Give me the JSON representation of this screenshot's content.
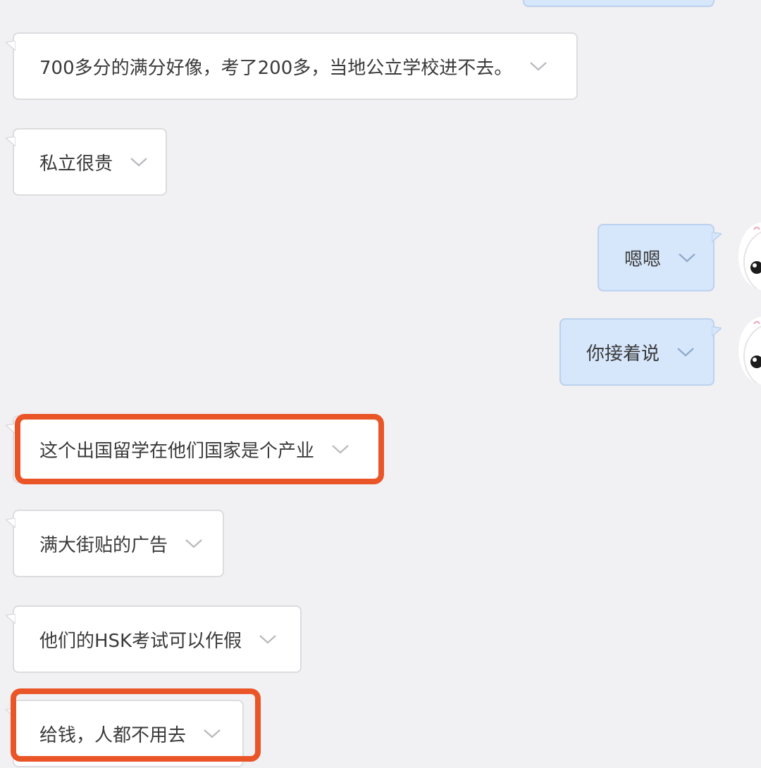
{
  "messages": [
    {
      "id": "m1",
      "side": "in",
      "text": "700多分的满分好像，考了200多，当地公立学校进不去。"
    },
    {
      "id": "m2",
      "side": "in",
      "text": "私立很贵"
    },
    {
      "id": "m3",
      "side": "out",
      "text": "嗯嗯"
    },
    {
      "id": "m4",
      "side": "out",
      "text": "你接着说"
    },
    {
      "id": "m5",
      "side": "in",
      "text": "这个出国留学在他们国家是个产业"
    },
    {
      "id": "m6",
      "side": "in",
      "text": "满大街贴的广告"
    },
    {
      "id": "m7",
      "side": "in",
      "text": "他们的HSK考试可以作假"
    },
    {
      "id": "m8",
      "side": "in",
      "text": "给钱，人都不用去"
    }
  ],
  "icons": {
    "expand": "chevron-down-icon",
    "avatar": "cartoon-avatar"
  },
  "colors": {
    "background": "#f1f0f3",
    "incoming_bubble": "#ffffff",
    "outgoing_bubble": "#d6e6fb",
    "highlight": "#ea5528"
  }
}
